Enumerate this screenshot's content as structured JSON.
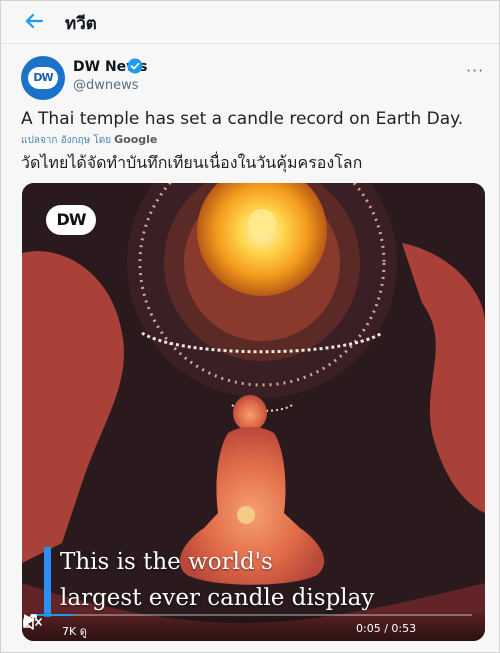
{
  "header": {
    "title": "ทวีต"
  },
  "tweet": {
    "author_name": "DW News",
    "author_handle": "@dwnews",
    "avatar_text": "DW",
    "text": "A Thai temple has set a candle record on Earth Day.",
    "translate_label": "แปลจาก อังกฤษ โดย",
    "translate_provider": "Google",
    "translated_text": "วัดไทยได้จัดทำบันทึกเทียนเนื่องในวันคุ้มครองโลก",
    "more_label": "···"
  },
  "video": {
    "logo_text": "DW",
    "caption_line_1": "This is the world's",
    "caption_line_2": "largest ever candle display",
    "views": "7K ดู",
    "time": "0:05 / 0:53",
    "progress": 0.09
  },
  "colors": {
    "accent": "#1d9bf0",
    "caption_bar": "#2a8ff7",
    "dw_blue": "#1a73c9"
  }
}
